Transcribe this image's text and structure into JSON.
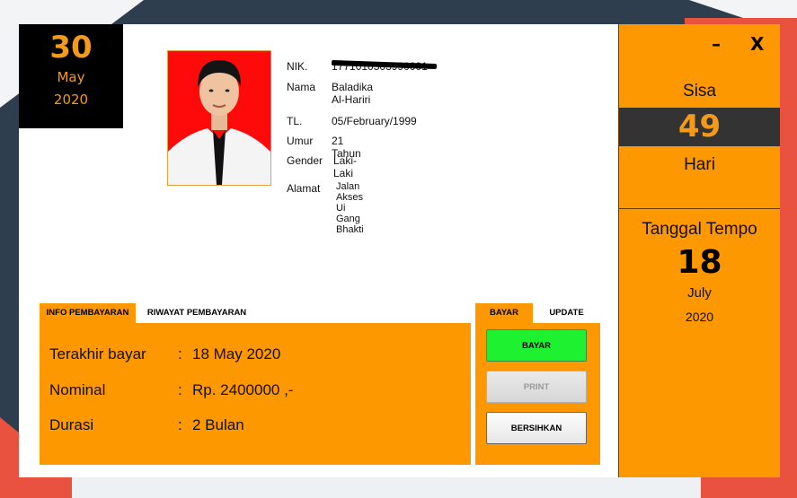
{
  "current_date": {
    "day": "30",
    "month": "May",
    "year": "2020"
  },
  "profile": {
    "photo_alt": "member-photo",
    "nik_label": "NIK.",
    "nik_value": "1771010503990001",
    "nama_label": "Nama",
    "nama_value": "Baladika Al-Hariri",
    "tl_label": "TL.",
    "tl_value": "05/February/1999",
    "umur_label": "Umur",
    "umur_value": "21  Tahun",
    "gender_label": "Gender",
    "gender_value": "Laki-Laki",
    "alamat_label": "Alamat",
    "alamat_value": "Jalan Akses Ui Gang Bhakti"
  },
  "tabs_left": [
    {
      "label": "INFO PEMBAYARAN",
      "active": true
    },
    {
      "label": "RIWAYAT PEMBAYARAN",
      "active": false
    }
  ],
  "payment_info": {
    "terakhir_label": "Terakhir bayar",
    "terakhir_value": "18 May 2020",
    "nominal_label": "Nominal",
    "nominal_value": "Rp. 2400000 ,-",
    "durasi_label": "Durasi",
    "durasi_value": "2 Bulan",
    "separator": ":"
  },
  "tabs_right": [
    {
      "label": "BAYAR",
      "active": true
    },
    {
      "label": "UPDATE",
      "active": false
    }
  ],
  "actions": {
    "bayar_label": "BAYAR",
    "print_label": "PRINT",
    "bersihkan_label": "BERSIHKAN"
  },
  "window_controls": {
    "minimize": "–",
    "close": "X"
  },
  "sidebar": {
    "sisa_label": "Sisa",
    "sisa_value": "49",
    "hari_label": "Hari",
    "tempo_label": "Tanggal Tempo",
    "tempo_day": "18",
    "tempo_month": "July",
    "tempo_year": "2020"
  },
  "colors": {
    "accent_orange": "#fd9800",
    "date_orange": "#f39a1a",
    "bayar_green": "#1ef230"
  }
}
